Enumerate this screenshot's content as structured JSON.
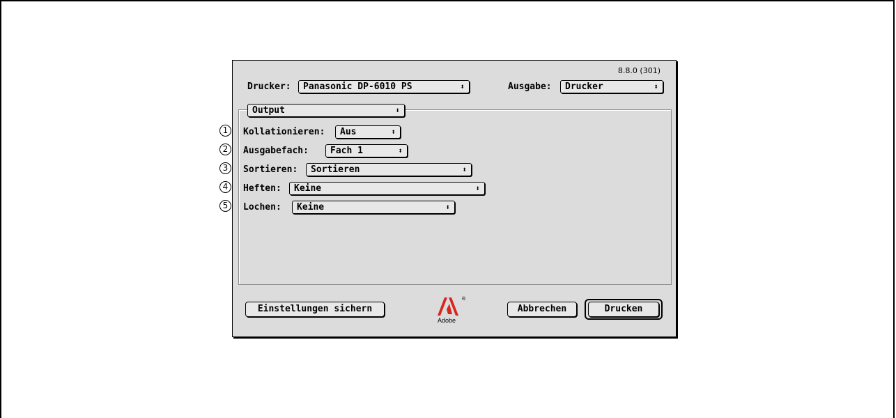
{
  "version": "8.8.0 (301)",
  "printer": {
    "label": "Drucker:",
    "value": "Panasonic DP-6010 PS"
  },
  "output": {
    "label": "Ausgabe:",
    "value": "Drucker"
  },
  "panel": {
    "value": "Output"
  },
  "options": [
    {
      "num": "1",
      "label": "Kollationieren:",
      "value": "Aus"
    },
    {
      "num": "2",
      "label": "Ausgabefach:",
      "value": "Fach 1"
    },
    {
      "num": "3",
      "label": "Sortieren:",
      "value": "Sortieren"
    },
    {
      "num": "4",
      "label": "Heften:",
      "value": "Keine"
    },
    {
      "num": "5",
      "label": "Lochen:",
      "value": "Keine"
    }
  ],
  "buttons": {
    "save": "Einstellungen sichern",
    "cancel": "Abbrechen",
    "print": "Drucken"
  },
  "logo": {
    "text": "Adobe",
    "color": "#d7261e"
  }
}
